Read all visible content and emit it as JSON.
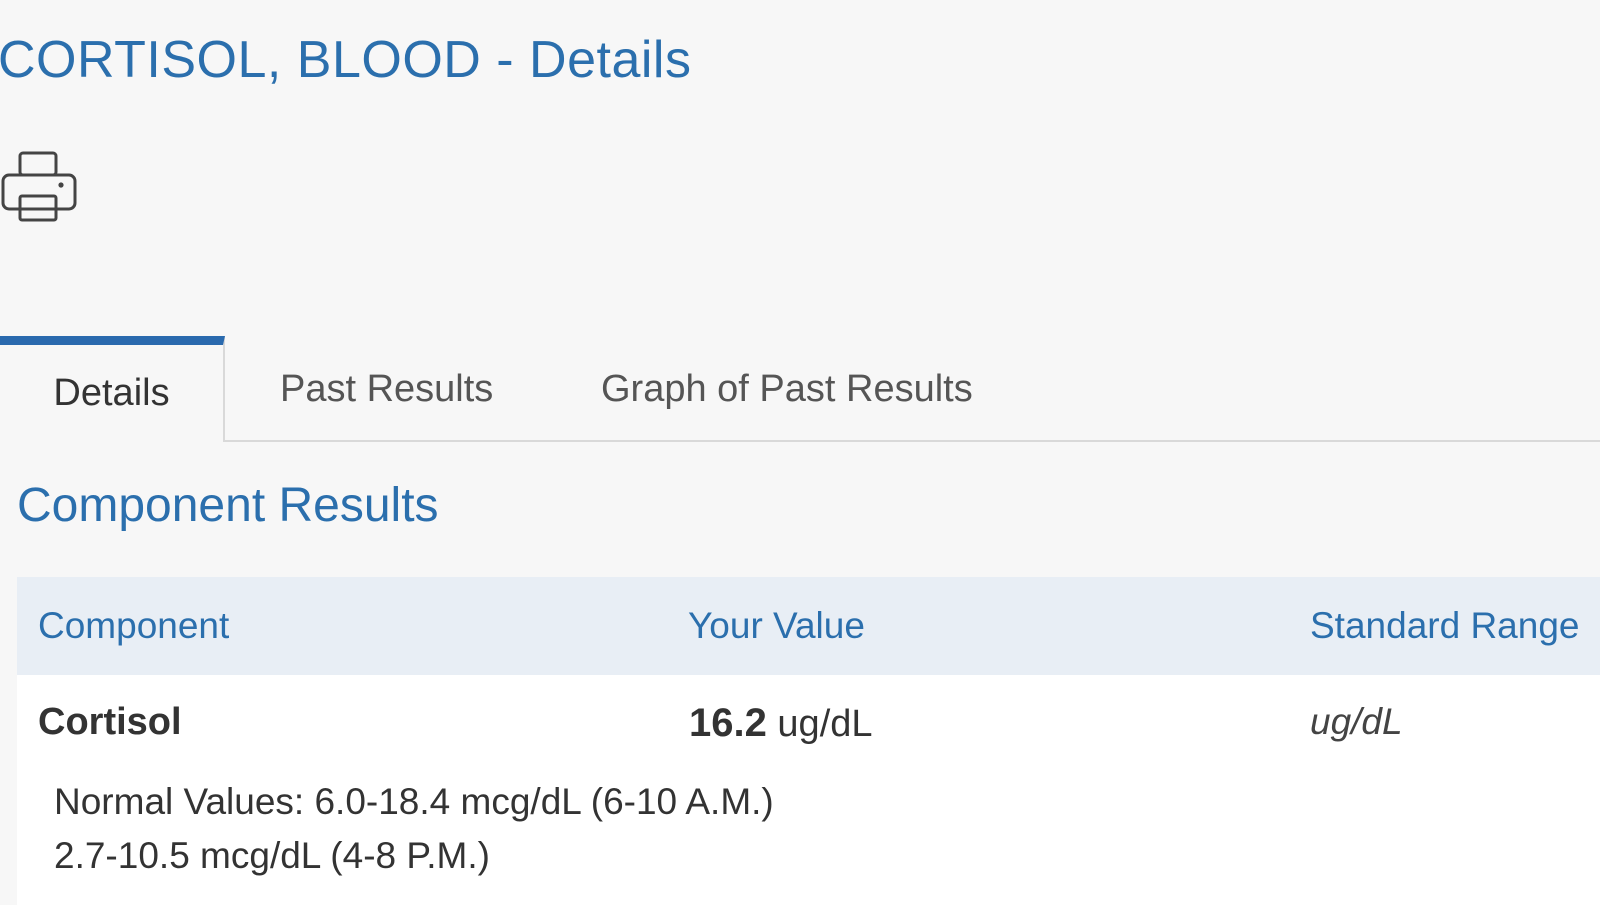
{
  "page": {
    "title": "CORTISOL, BLOOD - Details"
  },
  "toolbar": {
    "print_icon": "printer-icon"
  },
  "tabs": [
    {
      "label": "Details",
      "active": true
    },
    {
      "label": "Past Results",
      "active": false
    },
    {
      "label": "Graph of Past Results",
      "active": false
    }
  ],
  "section": {
    "title": "Component Results"
  },
  "table": {
    "headers": {
      "component": "Component",
      "value": "Your Value",
      "range": "Standard Range"
    },
    "rows": [
      {
        "component": "Cortisol",
        "value": "16.2",
        "unit": "ug/dL",
        "standard_range": "ug/dL",
        "notes": [
          "Normal Values: 6.0-18.4 mcg/dL (6-10 A.M.)",
          "2.7-10.5 mcg/dL (4-8 P.M.)"
        ]
      }
    ]
  },
  "colors": {
    "accent": "#2b6fad",
    "header_bg": "#e8eef5",
    "page_bg": "#f7f7f7",
    "active_tab_border": "#2a6aae"
  }
}
